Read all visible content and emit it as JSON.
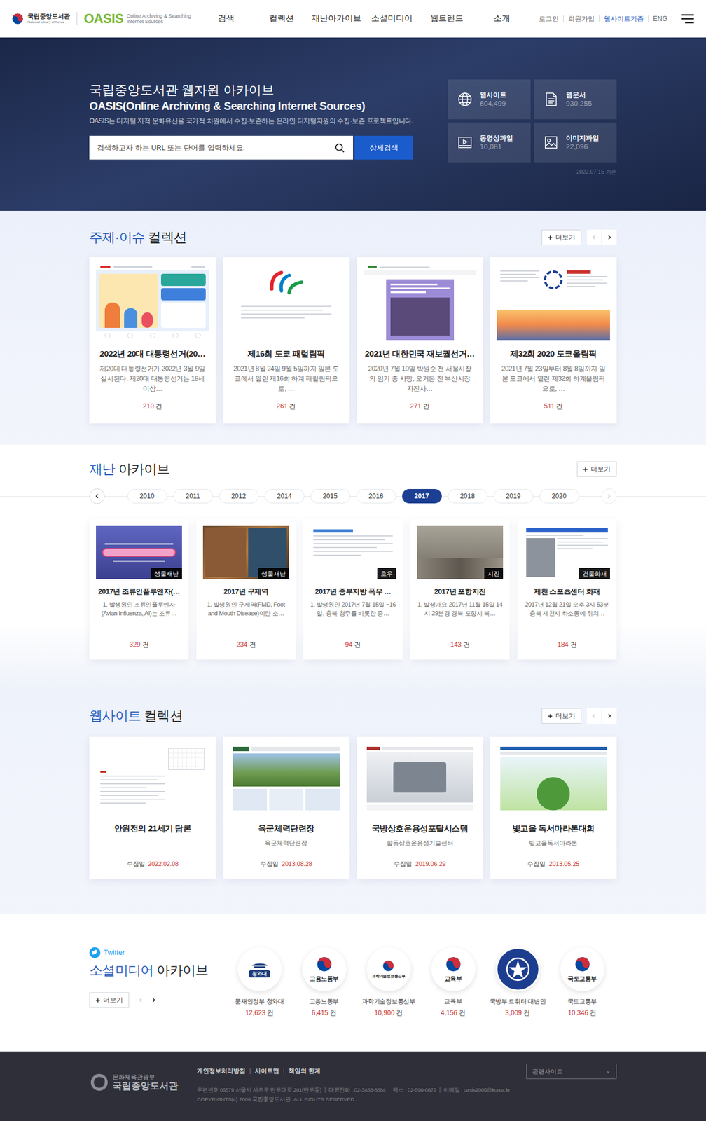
{
  "header": {
    "library_name": "국립중앙도서관",
    "library_name_en": "National Library of Korea",
    "service_name": "OASIS",
    "service_sub1": "Online Archiving & Searching",
    "service_sub2": "Internet Sources",
    "nav": [
      {
        "label": "검색"
      },
      {
        "label": "컬렉션"
      },
      {
        "label": "재난아카이브"
      },
      {
        "label": "소셜미디어"
      },
      {
        "label": "웹트렌드"
      },
      {
        "label": "소개"
      }
    ],
    "utility": [
      {
        "label": "로그인",
        "highlight": false
      },
      {
        "label": "회원가입",
        "highlight": false
      },
      {
        "label": "웹사이트기증",
        "highlight": true
      },
      {
        "label": "ENG",
        "highlight": false
      }
    ]
  },
  "hero": {
    "title": "국립중앙도서관 웹자원 아카이브",
    "subtitle": "OASIS(Online Archiving & Searching Internet Sources)",
    "description": "OASIS는 디지털 지적 문화유산을 국가적 차원에서 수집·보존하는 온라인 디지털자원의 수집·보존 프로젝트입니다.",
    "search": {
      "placeholder": "검색하고자 하는 URL 또는 단어를 입력하세요."
    },
    "search_button": "상세검색",
    "stats": [
      {
        "kind": "globe",
        "label": "웹사이트",
        "value": "604,499"
      },
      {
        "kind": "document",
        "label": "웹문서",
        "value": "930,255"
      },
      {
        "kind": "video",
        "label": "동영상파일",
        "value": "10,081"
      },
      {
        "kind": "image",
        "label": "이미지파일",
        "value": "22,096"
      }
    ],
    "stats_date": "2022.07.15 기준"
  },
  "theme_collection": {
    "title_accent": "주제·이슈",
    "title_rest": "컬렉션",
    "more": "더보기",
    "prev_disabled": true,
    "cards": [
      {
        "thumb": "election",
        "title": "2022년 20대 대통령선거(20…",
        "description": "제20대 대통령선거가 2022년 3월 9일 실시된다. 제20대 대통령선거는 18세 이상…",
        "count": "210",
        "unit": "건"
      },
      {
        "thumb": "paralympic",
        "title": "제16회 도쿄 패럴림픽",
        "description": "2021년 8월 24일 9월 5일까지 일본 도쿄에서 열린 제16회 하계 패럴림픽으로, …",
        "count": "261",
        "unit": "건"
      },
      {
        "thumb": "byelection",
        "title": "2021년 대한민국 재보궐선거…",
        "description": "2020년 7월 10일 박원순 전 서울시장의 임기 중 사망, 오거돈 전 부산시장 자진사…",
        "count": "271",
        "unit": "건"
      },
      {
        "thumb": "olympic",
        "title": "제32회 2020 도쿄올림픽",
        "description": "2021년 7월 23일부터 8월 8일까지 일본 도쿄에서 열린 제32회 하계올림픽으로, …",
        "count": "511",
        "unit": "건"
      }
    ]
  },
  "disaster_archive": {
    "title_accent": "재난",
    "title_rest": "아카이브",
    "more": "더보기",
    "prev_disabled": false,
    "next_disabled": true,
    "years": [
      {
        "label": "2010",
        "selected": false
      },
      {
        "label": "2011",
        "selected": false
      },
      {
        "label": "2012",
        "selected": false
      },
      {
        "label": "2014",
        "selected": false
      },
      {
        "label": "2015",
        "selected": false
      },
      {
        "label": "2016",
        "selected": false
      },
      {
        "label": "2017",
        "selected": true
      },
      {
        "label": "2018",
        "selected": false
      },
      {
        "label": "2019",
        "selected": false
      },
      {
        "label": "2020",
        "selected": false
      }
    ],
    "cards": [
      {
        "thumb": "poster",
        "tag": "생물재난",
        "title": "2017년 조류인플루엔자(…",
        "description": "1. 발생원인 조류인플루엔자 (Avian Influenza, AI)는 조류…",
        "count": "329",
        "unit": "건"
      },
      {
        "thumb": "market",
        "tag": "생물재난",
        "title": "2017년 구제역",
        "description": "1. 발생원인 구제역(FMD, Foot and Mouth Disease)이란 소…",
        "count": "234",
        "unit": "건"
      },
      {
        "thumb": "document",
        "tag": "호우",
        "title": "2017년 중부지방 폭우 …",
        "description": "1. 발생원인  2017년 7월 15일 ~16일, 충북 청주를 비롯한 중…",
        "count": "94",
        "unit": "건"
      },
      {
        "thumb": "rubble",
        "tag": "지진",
        "title": "2017년 포항지진",
        "description": "1. 발생개요 2017년 11월 15일 14시 29분경 경북 포항시 북…",
        "count": "143",
        "unit": "건"
      },
      {
        "thumb": "webpage",
        "tag": "건물화재",
        "title": "제천 스포츠센터 화재",
        "description": "2017년 12월 21일 오후 3시 53분 충북 제천시 하소동에 위치…",
        "count": "184",
        "unit": "건"
      }
    ]
  },
  "website_collection": {
    "title_accent": "웹사이트",
    "title_rest": "컬렉션",
    "more": "더보기",
    "prev_disabled": true,
    "cards": [
      {
        "thumb": "pagelines",
        "title": "안원전의 21세기 담론",
        "date_label": "수집일",
        "date": "2022.02.08"
      },
      {
        "thumb": "army",
        "title": "육군체력단련장",
        "subtitle": "육군체력단련장",
        "date_label": "수집일",
        "date": "2013.08.28"
      },
      {
        "thumb": "defense",
        "title": "국방상호운용성포탈시스템",
        "subtitle": "합동상호운용성기술센터",
        "date_label": "수집일",
        "date": "2019.06.29"
      },
      {
        "thumb": "reading",
        "title": "빛고을 독서마라톤대회",
        "subtitle": "빛고을독서마라톤",
        "date_label": "수집일",
        "date": "2013.05.25"
      }
    ]
  },
  "social_archive": {
    "platform": "Twitter",
    "title_accent": "소셜미디어",
    "title_rest": "아카이브",
    "more": "더보기",
    "prev_disabled": true,
    "accounts": [
      {
        "logo": "bluehouse",
        "logo_text": "청와대",
        "name": "문재인정부 청와대",
        "count": "12,623",
        "unit": "건"
      },
      {
        "logo": "taegeuk",
        "logo_text": "고용노동부",
        "name": "고용노동부",
        "count": "6,415",
        "unit": "건"
      },
      {
        "logo": "taegeuk-small",
        "logo_text": "과학기술정보통신부",
        "name": "과학기술정보통신부",
        "count": "10,900",
        "unit": "건"
      },
      {
        "logo": "taegeuk",
        "logo_text": "교육부",
        "name": "교육부",
        "count": "4,156",
        "unit": "건"
      },
      {
        "logo": "mnd",
        "name": "국방부 트위터 대변인",
        "count": "3,009",
        "unit": "건"
      },
      {
        "logo": "taegeuk",
        "logo_text": "국토교통부",
        "name": "국토교통부",
        "count": "10,346",
        "unit": "건"
      }
    ]
  },
  "footer": {
    "ministry": "문화체육관광부",
    "library": "국립중앙도서관",
    "links": [
      "개인정보처리방침",
      "사이트맵",
      "책임의 한계"
    ],
    "address_items": [
      "우편번호 06579 서울시 서초구 반포대로 201(반포동)",
      "대표전화 : 02-3483-8884",
      "팩스 : 02-590-0672",
      "이메일 : oasis2005@korea.kr"
    ],
    "copyright": "COPYRIGHTS(c) 2006 국립중앙도서관. ALL RIGHTS RESERVED.",
    "related_select": "관련사이트"
  }
}
